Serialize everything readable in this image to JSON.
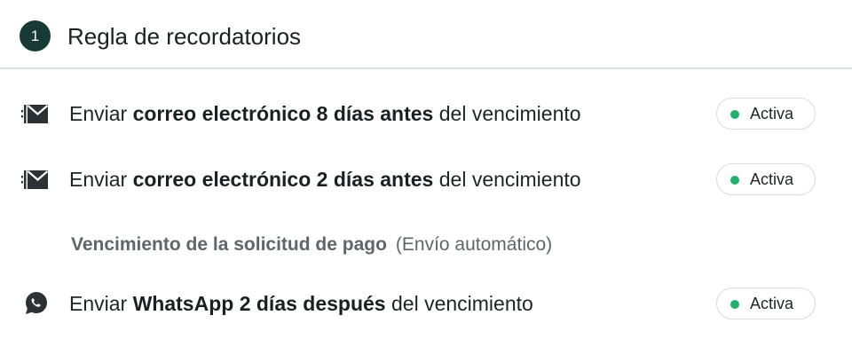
{
  "header": {
    "step_number": "1",
    "title": "Regla de recordatorios"
  },
  "rules": [
    {
      "icon": "send-mail-icon",
      "prefix": "Enviar ",
      "emphasis": "correo electrónico 8 días antes",
      "suffix": " del vencimiento",
      "status": "Activa"
    },
    {
      "icon": "send-mail-icon",
      "prefix": "Enviar ",
      "emphasis": "correo electrónico 2 días antes",
      "suffix": " del vencimiento",
      "status": "Activa"
    },
    {
      "icon": "whatsapp-icon",
      "prefix": "Enviar ",
      "emphasis": "WhatsApp 2 días después",
      "suffix": " del vencimiento",
      "status": "Activa"
    }
  ],
  "due": {
    "label": "Vencimiento de la solicitud de pago",
    "note": "(Envío automático)"
  },
  "colors": {
    "badge_bg": "#173a37",
    "status_active": "#1fb268",
    "divider": "#dcdfe1"
  }
}
